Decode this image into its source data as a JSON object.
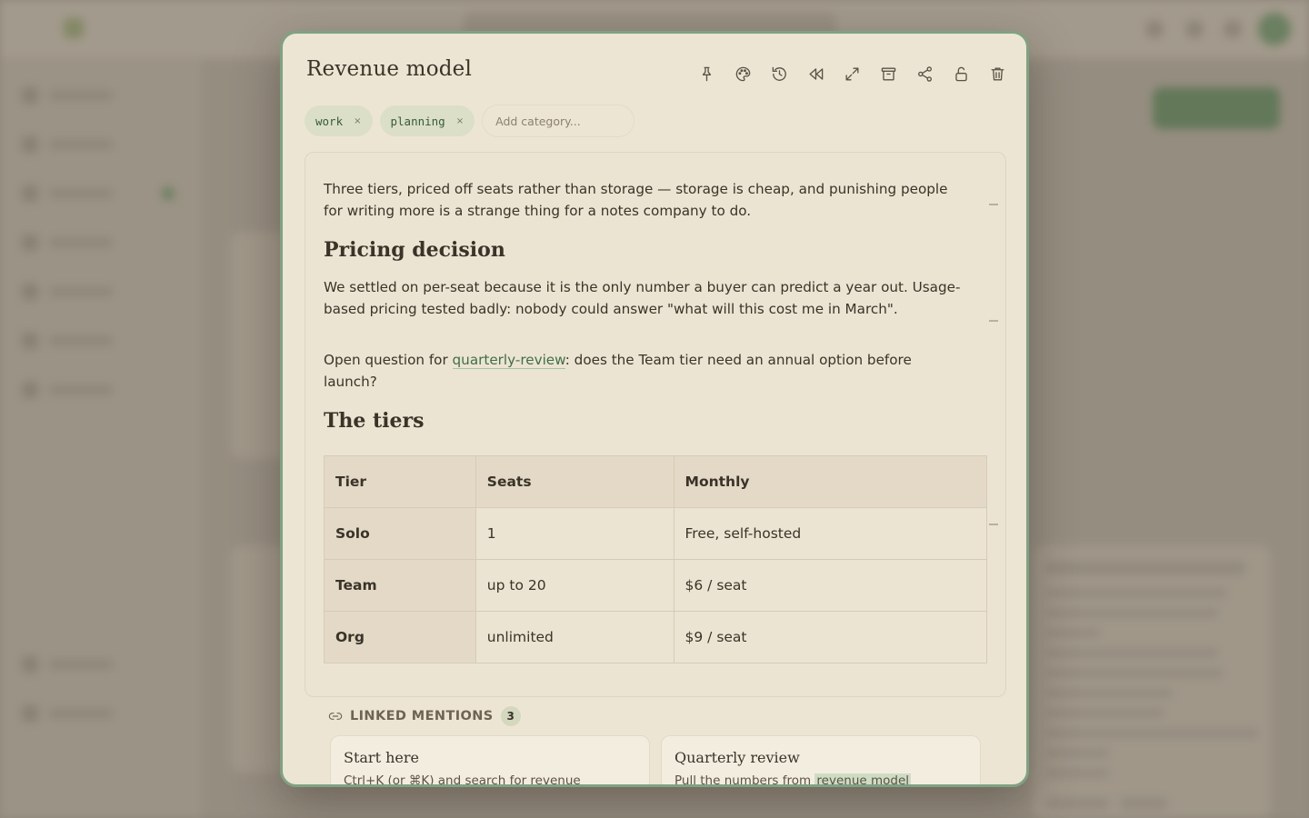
{
  "note": {
    "title": "Revenue model",
    "categories": [
      {
        "label": "work",
        "remove": "×"
      },
      {
        "label": "planning",
        "remove": "×"
      }
    ],
    "category_placeholder": "Add category..."
  },
  "toolbar": {
    "icons": [
      "pin-icon",
      "palette-icon",
      "history-icon",
      "rewind-icon",
      "expand-icon",
      "archive-icon",
      "share-icon",
      "lock-icon",
      "trash-icon"
    ]
  },
  "body": {
    "intro": "Three tiers, priced off seats rather than storage — storage is cheap, and punishing people for writing more is a strange thing for a notes company to do.",
    "heading1": "Pricing decision",
    "para2": "We settled on per-seat because it is the only number a buyer can predict a year out. Usage-based pricing tested badly: nobody could answer \"what will this cost me in March\".",
    "para3_prefix": "Open question for ",
    "para3_link": "quarterly-review",
    "para3_suffix": ": does the Team tier need an annual option before launch?",
    "heading2": "The tiers",
    "table": {
      "headers": [
        "Tier",
        "Seats",
        "Monthly"
      ],
      "rows": [
        [
          "Solo",
          "1",
          "Free, self-hosted"
        ],
        [
          "Team",
          "up to 20",
          "$6 / seat"
        ],
        [
          "Org",
          "unlimited",
          "$9 / seat"
        ]
      ]
    }
  },
  "linked_mentions": {
    "label": "LINKED MENTIONS",
    "count": "3",
    "cards": [
      {
        "title": "Start here",
        "snippet": "Ctrl+K (or ⌘K) and search for revenue",
        "highlight": ""
      },
      {
        "title": "Quarterly review",
        "snippet": "Pull the numbers from ",
        "highlight": "revenue model"
      }
    ]
  },
  "colors": {
    "accent": "#3e6f45",
    "dialog_bg": "#ede5d3",
    "dialog_border": "#7fa283",
    "chip_bg": "#dcdfc8"
  }
}
